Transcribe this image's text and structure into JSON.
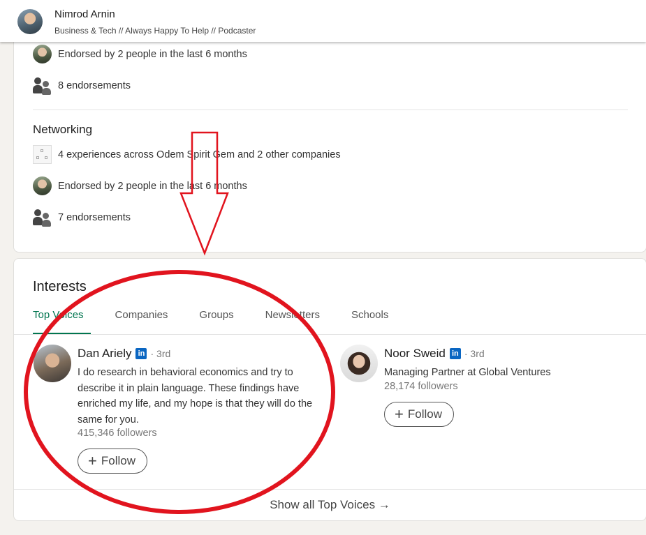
{
  "profile": {
    "name": "Nimrod Arnin",
    "headline": "Business & Tech // Always Happy To Help // Podcaster"
  },
  "skills": {
    "top_rows": [
      {
        "icon": "avatar-icon",
        "text": "Endorsed by 2 people in the last 6 months"
      },
      {
        "icon": "people-icon",
        "text": "8 endorsements"
      }
    ],
    "networking": {
      "title": "Networking",
      "rows": [
        {
          "icon": "company-icon",
          "text": "4 experiences across Odem Spirit Gem and 2 other companies"
        },
        {
          "icon": "avatar-icon",
          "text": "Endorsed by 2 people in the last 6 months"
        },
        {
          "icon": "people-icon",
          "text": "7 endorsements"
        }
      ]
    }
  },
  "interests": {
    "title": "Interests",
    "tabs": [
      "Top Voices",
      "Companies",
      "Groups",
      "Newsletters",
      "Schools"
    ],
    "active_tab": "Top Voices",
    "people": [
      {
        "name": "Dan Ariely",
        "badge": "in",
        "degree": "· 3rd",
        "description": "I do research in behavioral economics and try to describe it in plain language. These findings have enriched my life, and my hope is that they will do the same for you.",
        "followers": "415,346 followers",
        "follow_label": "Follow"
      },
      {
        "name": "Noor Sweid",
        "badge": "in",
        "degree": "· 3rd",
        "description": "Managing Partner at Global Ventures",
        "followers": "28,174 followers",
        "follow_label": "Follow"
      }
    ],
    "show_all": "Show all Top Voices →"
  },
  "colors": {
    "accent_green": "#01754f",
    "linkedin_blue": "#0a66c2",
    "annotation_red": "#e1141e"
  }
}
